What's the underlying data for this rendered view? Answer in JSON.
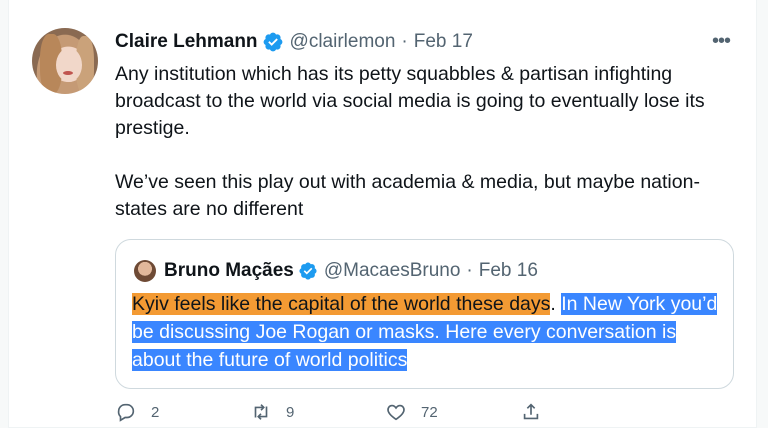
{
  "tweet": {
    "author_name": "Claire Lehmann",
    "handle": "@clairlemon",
    "date": "Feb 17",
    "more_label": "•••",
    "text": "Any institution which has its petty squabbles & partisan infighting broadcast to the world via social media is going to eventually lose its prestige.\n\nWe’ve seen this play out with academia & media, but maybe nation-states are no different",
    "separator": "·"
  },
  "quoted": {
    "author_name": "Bruno Maçães",
    "handle": "@MacaesBruno",
    "date": "Feb 16",
    "separator": "·",
    "text_highlight_orange": "Kyiv feels like the capital of the world these days",
    "text_period": ".",
    "text_highlight_blue": "In New York you’d be discussing Joe Rogan or masks. Here every conversation is about the future of world politics"
  },
  "actions": {
    "reply_count": "2",
    "retweet_count": "9",
    "like_count": "72"
  },
  "colors": {
    "verified": "#1d9bf0",
    "highlight_orange": "#f39a33",
    "highlight_blue": "#3a86ff",
    "muted": "#536471"
  }
}
